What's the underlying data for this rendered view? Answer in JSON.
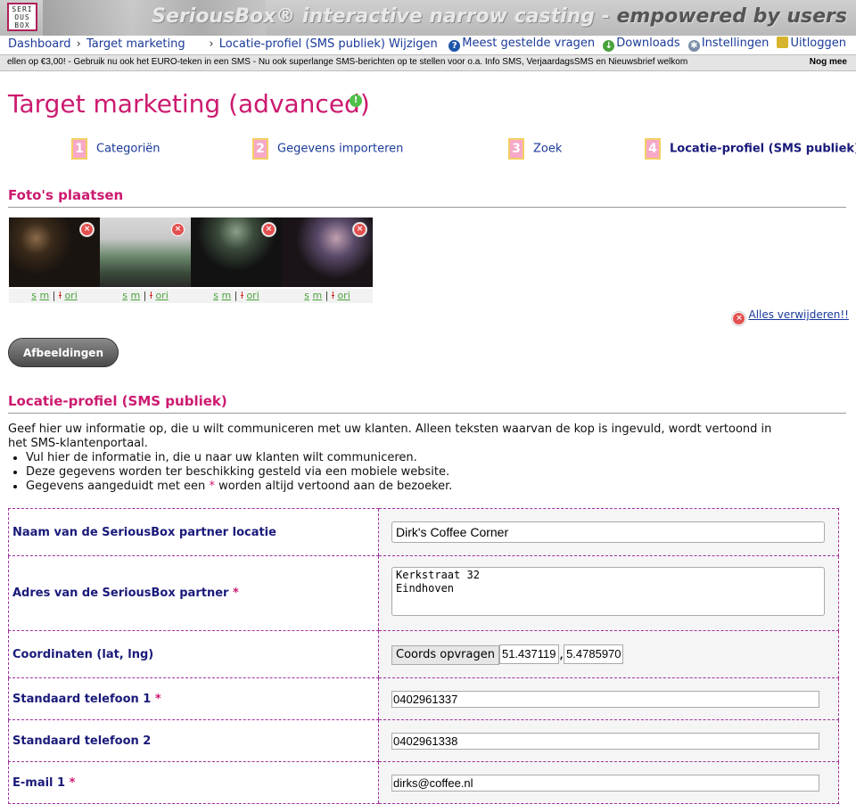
{
  "header": {
    "logo_text": "SERIOUSBOX",
    "tagline_main": "SeriousBox® interactive narrow casting - ",
    "tagline_em": "empowered by users"
  },
  "nav": {
    "crumbs": [
      "Dashboard",
      "Target marketing",
      "Locatie-profiel (SMS publiek) Wijzigen"
    ],
    "crumb_sep": "›",
    "right": [
      {
        "label": "Meest gestelde vragen",
        "icon": "help-icon"
      },
      {
        "label": "Downloads",
        "icon": "download-icon"
      },
      {
        "label": "Instellingen",
        "icon": "gear-icon"
      },
      {
        "label": "Uitloggen",
        "icon": "lock-icon"
      }
    ]
  },
  "ticker": {
    "text": "ellen op €3,00! - Gebruik nu ook het EURO-teken in een SMS - Nu ook superlange SMS-berichten op te stellen voor o.a. Info SMS, VerjaardagsSMS en Nieuwsbrief welkom",
    "right": "Nog mee"
  },
  "page": {
    "title": "Target marketing (advanced)"
  },
  "steps": [
    {
      "num": "1",
      "label": "Categoriën",
      "active": false
    },
    {
      "num": "2",
      "label": "Gegevens importeren",
      "active": false
    },
    {
      "num": "3",
      "label": "Zoek",
      "active": false
    },
    {
      "num": "4",
      "label": "Locatie-profiel (SMS publiek)",
      "active": true
    }
  ],
  "photos_section": {
    "title": "Foto's plaatsen",
    "size_links": {
      "s": "s",
      "m": "m",
      "l": "l",
      "ori": "ori",
      "sep": "|"
    },
    "delete_all": "Alles verwijderen!!",
    "images_button": "Afbeeldingen"
  },
  "profile_section": {
    "title": "Locatie-profiel (SMS publiek)",
    "intro": "Geef hier uw informatie op, die u wilt communiceren met uw klanten. Alleen teksten waarvan de kop is ingevuld, wordt vertoond in het SMS-klantenportaal.",
    "bullets": [
      "Vul hier de informatie in, die u naar uw klanten wilt communiceren.",
      "Deze gegevens worden ter beschikking gesteld via een mobiele website."
    ],
    "bullet3_pre": "Gegevens aangeduidt met een",
    "bullet3_star": "*",
    "bullet3_post": "worden altijd vertoond aan de bezoeker."
  },
  "form": {
    "required_mark": "*",
    "name_label": "Naam van de SeriousBox partner locatie",
    "name_value": "Dirk's Coffee Corner",
    "address_label": "Adres van de SeriousBox partner",
    "address_value": "Kerkstraat 32\nEindhoven",
    "coords_label": "Coordinaten (lat, lng)",
    "coords_button": "Coords opvragen",
    "lat": "51.437119",
    "lng": "5.4785970",
    "coords_sep": ",",
    "phone1_label": "Standaard telefoon 1",
    "phone1_value": "0402961337",
    "phone2_label": "Standaard telefoon 2",
    "phone2_value": "0402961338",
    "email1_label": "E-mail 1",
    "email1_value": "dirks@coffee.nl"
  },
  "colors": {
    "accent": "#cc1a6f",
    "link": "#1a3a9a",
    "label": "#1a1a7a"
  }
}
